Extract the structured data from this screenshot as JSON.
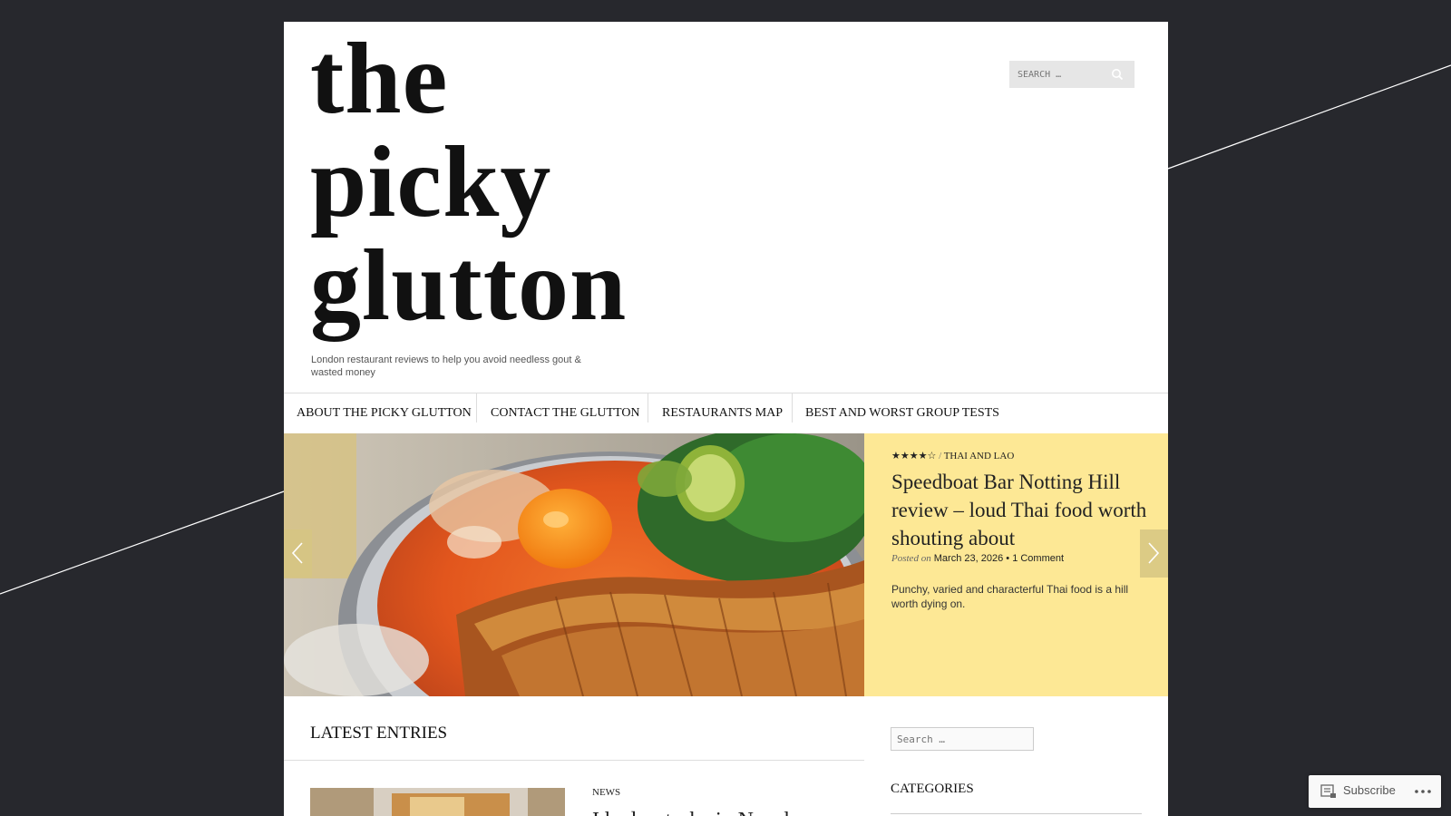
{
  "header": {
    "title_line1": "the",
    "title_line2": "picky",
    "title_line3": "glutton",
    "tagline": "London restaurant reviews to help you avoid needless gout & wasted money",
    "search_placeholder": "SEARCH …"
  },
  "nav": {
    "items": [
      {
        "label": "ABOUT THE PICKY GLUTTON"
      },
      {
        "label": "CONTACT THE GLUTTON"
      },
      {
        "label": "RESTAURANTS MAP"
      },
      {
        "label": "BEST AND WORST GROUP TESTS"
      }
    ]
  },
  "featured": {
    "rating": "★★★★☆",
    "separator": "/",
    "category": "THAI AND LAO",
    "title": "Speedboat Bar Notting Hill review – loud Thai food worth shouting about",
    "posted_prefix": "Posted on",
    "date": "March 23, 2026",
    "bullet": "•",
    "comments": "1 Comment",
    "excerpt": "Punchy, varied and characterful Thai food is a hill worth dying on."
  },
  "latest": {
    "heading": "LATEST ENTRIES",
    "entry_category": "NEWS",
    "entry_title": "I had a stroke in Nepal"
  },
  "sidebar": {
    "search_placeholder": "Search …",
    "categories_heading": "CATEGORIES"
  },
  "subscribe": {
    "label": "Subscribe"
  },
  "colors": {
    "background": "#27282d",
    "featured_panel": "#fde895"
  }
}
